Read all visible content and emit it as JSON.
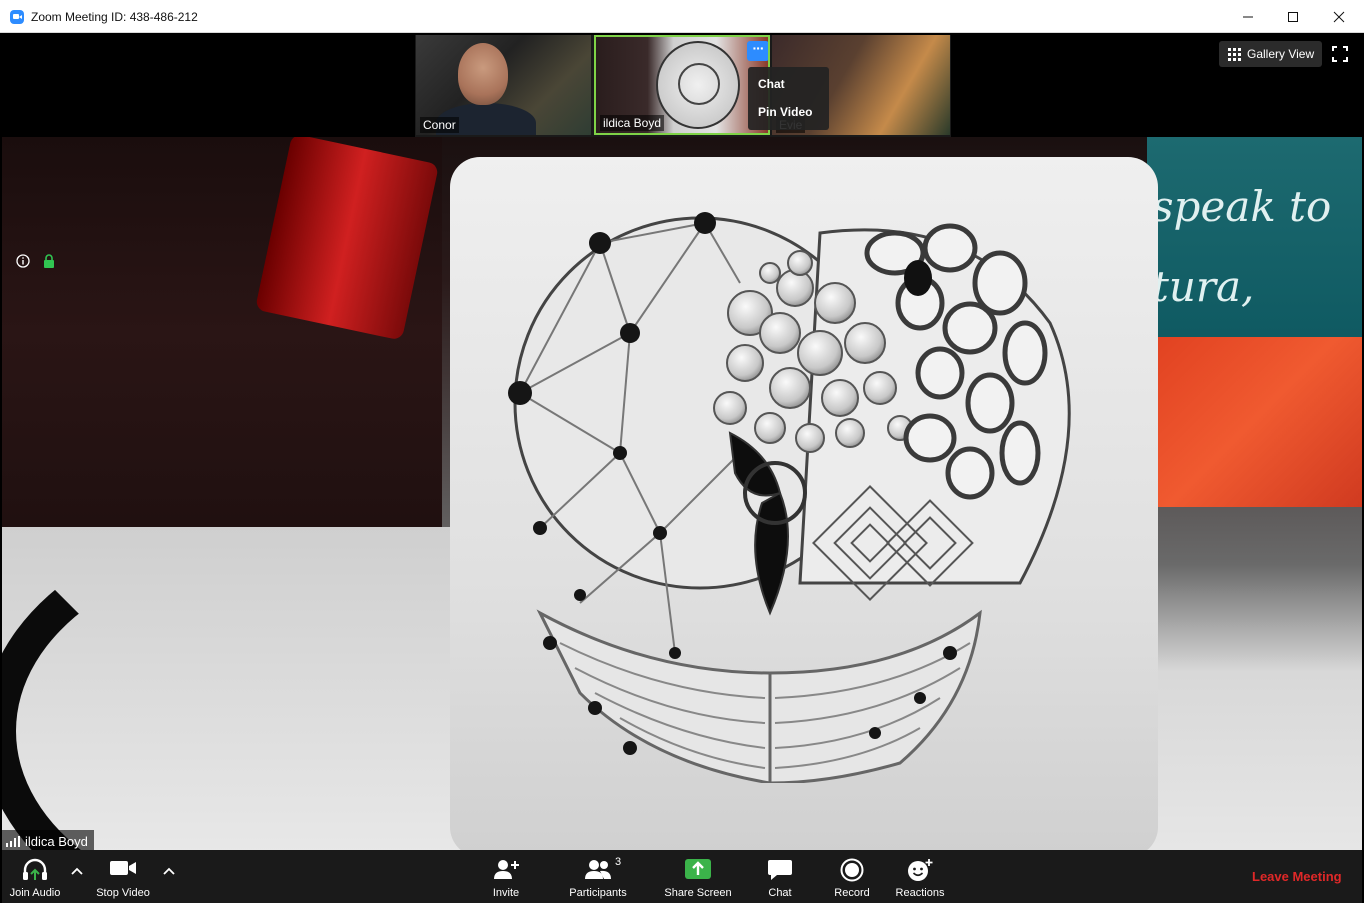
{
  "window": {
    "title": "Zoom Meeting ID: 438-486-212",
    "controls": [
      "minimize",
      "maximize",
      "close"
    ]
  },
  "thumbnails": [
    {
      "name": "Conor"
    },
    {
      "name": "ildica Boyd",
      "active": true
    },
    {
      "name": "Evie"
    }
  ],
  "context_menu": {
    "items": [
      "Chat",
      "Pin Video"
    ]
  },
  "view": {
    "gallery_label": "Gallery View"
  },
  "main_video": {
    "speaker_name": "ildica Boyd",
    "background_text_line1": "speak to",
    "background_text_line2": "tura, Drama"
  },
  "toolbar": {
    "join_audio": "Join Audio",
    "stop_video": "Stop Video",
    "invite": "Invite",
    "participants": "Participants",
    "participant_count": "3",
    "share_screen": "Share Screen",
    "chat": "Chat",
    "record": "Record",
    "reactions": "Reactions",
    "leave": "Leave Meeting"
  },
  "colors": {
    "accent": "#2d8cff",
    "share_green": "#3bb34a",
    "leave_red": "#e02828",
    "active_border": "#7fd347"
  }
}
